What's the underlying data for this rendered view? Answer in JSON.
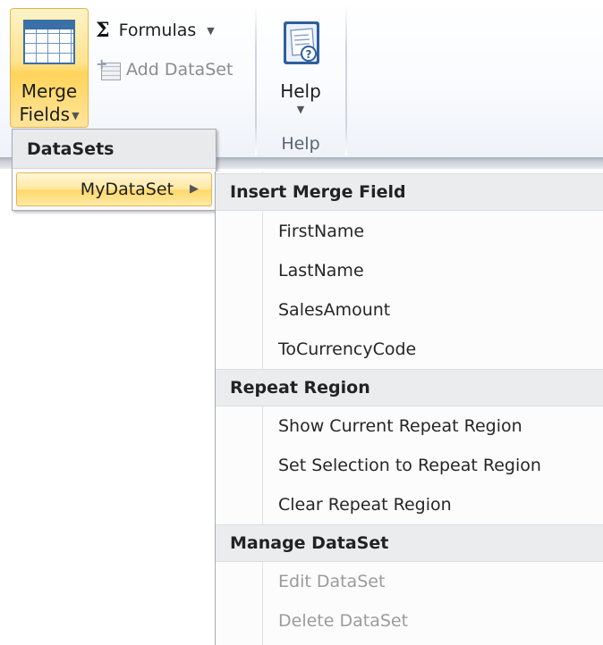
{
  "ribbon": {
    "merge_fields_line1": "Merge",
    "merge_fields_line2": "Fields",
    "formulas_label": "Formulas",
    "add_dataset_label": "Add DataSet",
    "help_label": "Help",
    "help_group_label": "Help",
    "icons": {
      "merge": "table-grid-icon",
      "formulas": "sigma-icon",
      "add_dataset": "add-dataset-icon",
      "help": "help-book-icon",
      "dropdown": "chevron-down-icon"
    }
  },
  "datasets_menu": {
    "header": "DataSets",
    "items": [
      {
        "label": "MyDataSet",
        "has_submenu": true
      }
    ]
  },
  "submenu": {
    "insert_merge_field": {
      "header": "Insert Merge Field",
      "items": [
        "FirstName",
        "LastName",
        "SalesAmount",
        "ToCurrencyCode"
      ]
    },
    "repeat_region": {
      "header": "Repeat Region",
      "items": [
        "Show Current Repeat Region",
        "Set Selection to Repeat Region",
        "Clear Repeat Region"
      ]
    },
    "manage_dataset": {
      "header": "Manage DataSet",
      "items": [
        "Edit DataSet",
        "Delete DataSet"
      ]
    }
  },
  "colors": {
    "highlight_border": "#e5b551",
    "highlight_fill": "#ffe38f",
    "disabled_text": "#9b9b9b",
    "menu_header_bg": "#ebecee"
  }
}
